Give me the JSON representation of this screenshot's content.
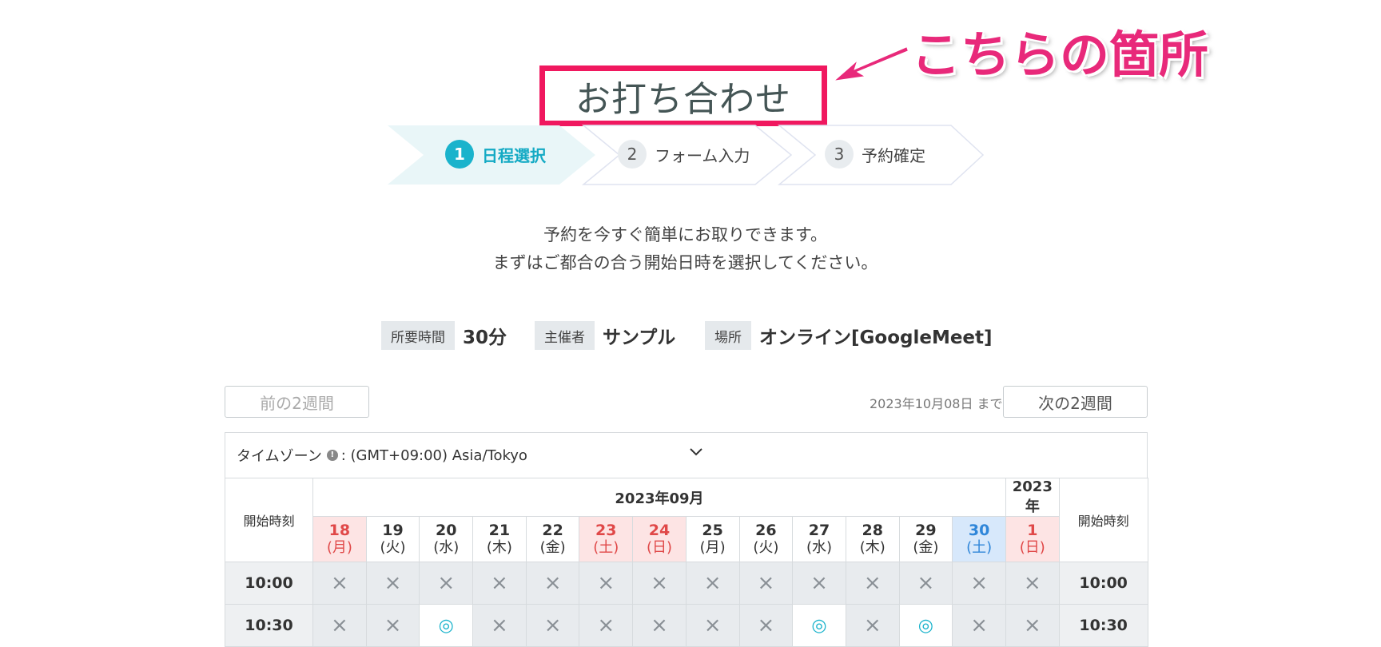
{
  "title": "お打ち合わせ",
  "annotation": "こちらの箇所",
  "steps": [
    {
      "num": "1",
      "label": "日程選択"
    },
    {
      "num": "2",
      "label": "フォーム入力"
    },
    {
      "num": "3",
      "label": "予約確定"
    }
  ],
  "intro": {
    "line1": "予約を今すぐ簡単にお取りできます。",
    "line2": "まずはご都合の合う開始日時を選択してください。"
  },
  "info": {
    "duration_label": "所要時間",
    "duration": "30分",
    "host_label": "主催者",
    "host": "サンプル",
    "place_label": "場所",
    "place": "オンライン[GoogleMeet]"
  },
  "nav": {
    "prev": "前の2週間",
    "next": "次の2週間",
    "until": "2023年10月08日 まで"
  },
  "timezone": {
    "label": "タイムゾーン",
    "value": ": (GMT+09:00) Asia/Tokyo"
  },
  "calendar": {
    "start_time_label": "開始時刻",
    "month1": "2023年09月",
    "month2": "2023年",
    "days": [
      {
        "d": "18",
        "w": "(月)",
        "style": "red"
      },
      {
        "d": "19",
        "w": "(火)",
        "style": ""
      },
      {
        "d": "20",
        "w": "(水)",
        "style": ""
      },
      {
        "d": "21",
        "w": "(木)",
        "style": ""
      },
      {
        "d": "22",
        "w": "(金)",
        "style": ""
      },
      {
        "d": "23",
        "w": "(土)",
        "style": "red"
      },
      {
        "d": "24",
        "w": "(日)",
        "style": "red"
      },
      {
        "d": "25",
        "w": "(月)",
        "style": ""
      },
      {
        "d": "26",
        "w": "(火)",
        "style": ""
      },
      {
        "d": "27",
        "w": "(水)",
        "style": ""
      },
      {
        "d": "28",
        "w": "(木)",
        "style": ""
      },
      {
        "d": "29",
        "w": "(金)",
        "style": ""
      },
      {
        "d": "30",
        "w": "(土)",
        "style": "sat"
      },
      {
        "d": "1",
        "w": "(日)",
        "style": "red"
      }
    ],
    "rows": [
      {
        "time": "10:00",
        "slots": [
          "×",
          "×",
          "×",
          "×",
          "×",
          "×",
          "×",
          "×",
          "×",
          "×",
          "×",
          "×",
          "×",
          "×"
        ]
      },
      {
        "time": "10:30",
        "slots": [
          "×",
          "×",
          "◎",
          "×",
          "×",
          "×",
          "×",
          "×",
          "×",
          "◎",
          "×",
          "◎",
          "×",
          "×"
        ]
      }
    ]
  },
  "colors": {
    "accent": "#1ab3cc",
    "annotation": "#e8297a",
    "holiday": "#e04848",
    "saturday": "#2f86d9"
  }
}
